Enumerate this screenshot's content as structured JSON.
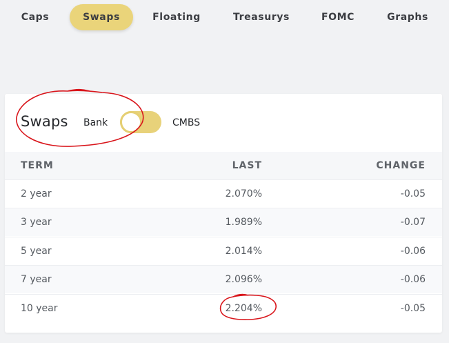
{
  "nav": {
    "tabs": [
      {
        "label": "Caps",
        "active": false
      },
      {
        "label": "Swaps",
        "active": true
      },
      {
        "label": "Floating",
        "active": false
      },
      {
        "label": "Treasurys",
        "active": false
      },
      {
        "label": "FOMC",
        "active": false
      },
      {
        "label": "Graphs",
        "active": false
      }
    ]
  },
  "card": {
    "title": "Swaps",
    "toggle": {
      "left_label": "Bank",
      "right_label": "CMBS",
      "selected": "Bank"
    }
  },
  "table": {
    "headers": {
      "term": "TERM",
      "last": "LAST",
      "change": "CHANGE"
    },
    "rows": [
      {
        "term": "2 year",
        "last": "2.070%",
        "change": "-0.05"
      },
      {
        "term": "3 year",
        "last": "1.989%",
        "change": "-0.07"
      },
      {
        "term": "5 year",
        "last": "2.014%",
        "change": "-0.06"
      },
      {
        "term": "7 year",
        "last": "2.096%",
        "change": "-0.06"
      },
      {
        "term": "10 year",
        "last": "2.204%",
        "change": "-0.05"
      }
    ]
  },
  "colors": {
    "accent": "#ead47a",
    "annotation": "#d9161c",
    "background": "#f1f2f4"
  }
}
